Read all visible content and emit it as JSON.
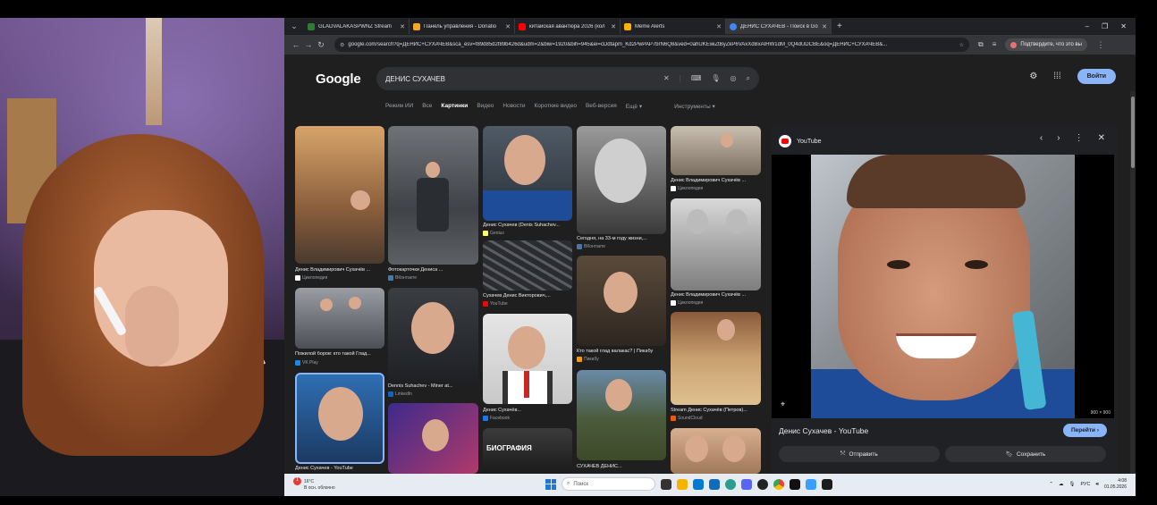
{
  "browser": {
    "tabs": [
      {
        "label": "GLADVALAKASPWNZ Stream",
        "color": "#2e7d32",
        "active": false
      },
      {
        "label": "Панель управления - Donatio",
        "color": "#f9a825",
        "active": false
      },
      {
        "label": "китайская авантюра 2026 (кол",
        "color": "#ff0000",
        "active": false
      },
      {
        "label": "Meme Alerts",
        "color": "#ffb300",
        "active": false
      },
      {
        "label": "ДЕНИС СУХАЧЕВ - Поиск в Go",
        "color": "#4285f4",
        "active": true
      }
    ],
    "new_tab": "+",
    "window_controls": {
      "minimize": "–",
      "restore": "❐",
      "close": "✕"
    },
    "nav": {
      "back": "←",
      "forward": "→",
      "reload": "↻"
    },
    "url": "google.com/search?q=ДЕНИС+СУХАЧЕВ&sca_esv=f89d85d2f89b426d&udm=2&biw=1920&bih=945&ei=cDdtapm_Kd2PwPAP7brN6Q8&ved=0ahUKEwiZtByZkP6VAxXdBxAIHW1dM_0Q4dUDCBE&oq=ДЕНИС+СУХАЧЕВ&...",
    "profile_chip": "Подтвердите, что это вы"
  },
  "google": {
    "logo": "Google",
    "query": "ДЕНИС СУХАЧЕВ",
    "tabs": [
      "Режим ИИ",
      "Все",
      "Картинки",
      "Видео",
      "Новости",
      "Короткие видео",
      "Веб-версия",
      "Ещё ▾"
    ],
    "selected_tab": "Картинки",
    "tools": "Инструменты ▾",
    "signin": "Войти"
  },
  "results": [
    {
      "caption": "Денис Владимирович Сухачёв ...",
      "source": "Циклопедия",
      "src_color": "#ffffff"
    },
    {
      "caption": "Фотокарточки Дениса ...",
      "source": "ВКонтакте",
      "src_color": "#4a76a8"
    },
    {
      "caption": "Денис Сухачев (Denis Suhachev...",
      "source": "Genius",
      "src_color": "#ffff64"
    },
    {
      "caption": "Сегодня, на 33-м году жизни,...",
      "source": "ВКонтакте",
      "src_color": "#4a76a8"
    },
    {
      "caption": "Денис Владимирович Сухачёв ...",
      "source": "Циклопедия",
      "src_color": "#ffffff"
    },
    {
      "caption": "Сухачев Денис Викторович,...",
      "source": "YouTube",
      "src_color": "#ff0000"
    },
    {
      "caption": "Денис Владимирович Сухачёв ...",
      "source": "Циклопедия",
      "src_color": "#ffffff"
    },
    {
      "caption": "Пожилой боров: кто такой Глад...",
      "source": "VK Play",
      "src_color": "#1e88e5"
    },
    {
      "caption": "Dennis Suhachev - Miner at...",
      "source": "LinkedIn",
      "src_color": "#0a66c2"
    },
    {
      "caption": "Денис Сухачёв...",
      "source": "Facebook",
      "src_color": "#1877f2"
    },
    {
      "caption": "Кто такой глад валакас? | Пикабу",
      "source": "Пикабу",
      "src_color": "#ff9800"
    },
    {
      "caption": "Stream Денис Сухачёв (Петров)...",
      "source": "SoundCloud",
      "src_color": "#ff5500"
    },
    {
      "caption": "Денис Сухачев - YouTube",
      "source": "",
      "src_color": "#ff0000"
    },
    {
      "caption": "СУХАЧЁВ ДЕНИС...",
      "source": "",
      "src_color": "#4a76a8"
    },
    {
      "caption": "БИОГРАФИЯ",
      "source": "",
      "src_color": "#ffffff"
    }
  ],
  "preview": {
    "source": "YouTube",
    "title": "Денис Сухачев - YouTube",
    "visit": "Перейти ›",
    "share": "Отправить",
    "save": "Сохранить",
    "size": "900 × 900"
  },
  "taskbar": {
    "weather_temp": "16°C",
    "weather_desc": "В осн. облачно",
    "search": "Поиск",
    "lang": "РУС",
    "time": "4:08",
    "date": "01.05.2026"
  }
}
